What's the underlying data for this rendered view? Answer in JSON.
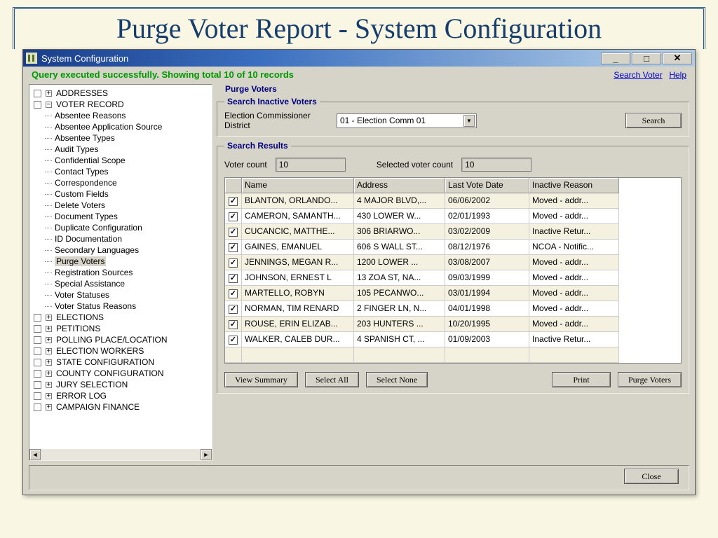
{
  "slide_title": "Purge Voter Report  - System Configuration",
  "window_title": "System Configuration",
  "win_btns": {
    "min": "_",
    "max": "□",
    "close": "✕"
  },
  "status_msg": "Query executed successfully. Showing total 10 of 10 records",
  "links": {
    "search_voter": "Search Voter",
    "help": "Help"
  },
  "tree": {
    "roots_before": [
      "ADDRESSES"
    ],
    "expanded_root": "VOTER RECORD",
    "children": [
      "Absentee Reasons",
      "Absentee Application Source",
      "Absentee Types",
      "Audit Types",
      "Confidential Scope",
      "Contact Types",
      "Correspondence",
      "Custom Fields",
      "Delete Voters",
      "Document Types",
      "Duplicate Configuration",
      "ID Documentation",
      "Secondary Languages",
      "Purge Voters",
      "Registration Sources",
      "Special Assistance",
      "Voter Statuses",
      "Voter Status Reasons"
    ],
    "selected_child": "Purge Voters",
    "roots_after": [
      "ELECTIONS",
      "PETITIONS",
      "POLLING PLACE/LOCATION",
      "ELECTION WORKERS",
      "STATE CONFIGURATION",
      "COUNTY CONFIGURATION",
      "JURY SELECTION",
      "ERROR LOG",
      "CAMPAIGN FINANCE"
    ]
  },
  "panel_title": "Purge Voters",
  "search_box": {
    "legend": "Search Inactive Voters",
    "label": "Election Commissioner District",
    "value": "01 - Election Comm 01",
    "button": "Search"
  },
  "results_box": {
    "legend": "Search Results",
    "voter_count_label": "Voter count",
    "voter_count": "10",
    "selected_count_label": "Selected voter count",
    "selected_count": "10",
    "columns": [
      "Name",
      "Address",
      "Last Vote Date",
      "Inactive Reason"
    ],
    "rows": [
      {
        "name": "BLANTON, ORLANDO...",
        "addr": "4 MAJOR BLVD,...",
        "date": "06/06/2002",
        "reason": "Moved - addr..."
      },
      {
        "name": "CAMERON, SAMANTH...",
        "addr": "430 LOWER W...",
        "date": "02/01/1993",
        "reason": "Moved - addr..."
      },
      {
        "name": "CUCANCIC, MATTHE...",
        "addr": "306 BRIARWO...",
        "date": "03/02/2009",
        "reason": "Inactive Retur..."
      },
      {
        "name": "GAINES, EMANUEL",
        "addr": "606 S WALL ST...",
        "date": "08/12/1976",
        "reason": "NCOA - Notific..."
      },
      {
        "name": "JENNINGS, MEGAN R...",
        "addr": "1200 LOWER ...",
        "date": "03/08/2007",
        "reason": "Moved - addr..."
      },
      {
        "name": "JOHNSON, ERNEST L",
        "addr": "13 ZOA ST, NA...",
        "date": "09/03/1999",
        "reason": "Moved - addr..."
      },
      {
        "name": "MARTELLO, ROBYN",
        "addr": "105 PECANWO...",
        "date": "03/01/1994",
        "reason": "Moved - addr..."
      },
      {
        "name": "NORMAN, TIM RENARD",
        "addr": "2 FINGER LN, N...",
        "date": "04/01/1998",
        "reason": "Moved - addr..."
      },
      {
        "name": "ROUSE, ERIN ELIZAB...",
        "addr": "203 HUNTERS ...",
        "date": "10/20/1995",
        "reason": "Moved - addr..."
      },
      {
        "name": "WALKER, CALEB DUR...",
        "addr": "4 SPANISH CT, ...",
        "date": "01/09/2003",
        "reason": "Inactive Retur..."
      }
    ],
    "buttons": {
      "view_summary": "View Summary",
      "select_all": "Select All",
      "select_none": "Select None",
      "print": "Print",
      "purge": "Purge Voters"
    }
  },
  "close_button": "Close"
}
